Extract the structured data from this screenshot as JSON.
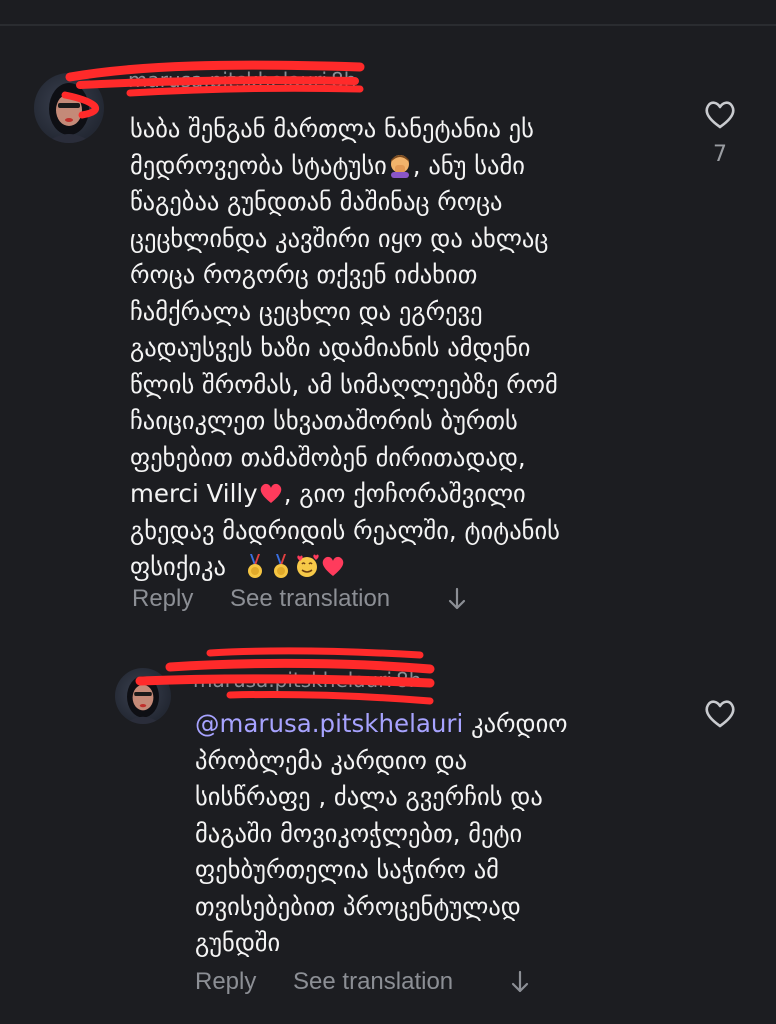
{
  "comments": [
    {
      "username": "marusa.pitskhelauri",
      "time": "8h",
      "lines": [
        "საბა შენგან მართლა ნანეტანია ეს",
        "მედროვეობა სტატუსი",
        "წაგებაა გუნდთან მაშინაც როცა",
        "ცეცხლინდა კავშირი იყო და ახლაც",
        "როცა როგორც თქვენ იძახით",
        "ჩამქრალა ცეცხლი და ეგრევე",
        "გადაუსვეს ხაზი ადამიანის ამდენი",
        "წლის შრომას,  ამ სიმაღლეებზე რომ",
        "ჩაიციკლეთ სხვათაშორის ბურთს",
        "ფეხებით თამაშობენ ძირითადად,",
        "merci Villy",
        "გხედავ მადრიდის რეალში, ტიტანის",
        "ფსიქიკა"
      ],
      "line2_suffix": ", ანუ სამი",
      "line11_suffix": ", გიო ქოჩორაშვილი",
      "like_count": "7",
      "reply_label": "Reply",
      "see_translation_label": "See translation",
      "icons": {
        "facepalm": "woman-facepalming-emoji",
        "heart": "red-heart-emoji",
        "medal": "sports-medal-emoji",
        "smiling_hearts": "smiling-face-with-hearts-emoji"
      }
    },
    {
      "username": "marusa.pitskhelauri",
      "time": "8h",
      "mention": "@marusa.pitskhelauri",
      "first_line_rest": " კარდიო",
      "lines": [
        "პრობლემა კარდიო და",
        "სისწრაფე , ძალა გვერჩის და",
        "მაგაში მოვიკოჭლებთ, მეტი",
        "ფეხბურთელია საჭირო ამ",
        "თვისებებით პროცენტულად",
        "გუნდში"
      ],
      "reply_label": "Reply",
      "see_translation_label": "See translation"
    }
  ],
  "colors": {
    "background": "#1c1d21",
    "text": "#f4f4f4",
    "muted": "#8c8f95",
    "mention": "#a7a3ff",
    "redaction": "#ff2a2a"
  }
}
